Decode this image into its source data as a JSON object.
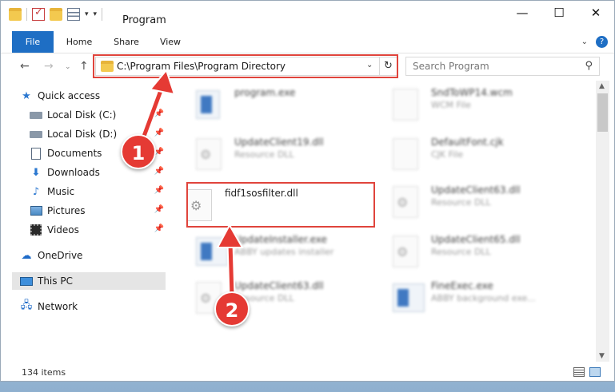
{
  "window": {
    "title": "Program"
  },
  "ribbon": {
    "tabs": [
      "File",
      "Home",
      "Share",
      "View"
    ]
  },
  "address": {
    "path": "C:\\Program Files\\Program Directory",
    "search_placeholder": "Search Program"
  },
  "sidebar": {
    "quick_access": "Quick access",
    "items": [
      {
        "label": "Local Disk (C:)"
      },
      {
        "label": "Local Disk (D:)"
      },
      {
        "label": "Documents"
      },
      {
        "label": "Downloads"
      },
      {
        "label": "Music"
      },
      {
        "label": "Pictures"
      },
      {
        "label": "Videos"
      }
    ],
    "onedrive": "OneDrive",
    "this_pc": "This PC",
    "network": "Network"
  },
  "files": {
    "program_exe": {
      "name": "program.exe"
    },
    "sndtowp": {
      "name": "SndToWP14.wcm",
      "desc": "WCM File"
    },
    "updateclient19": {
      "name": "UpdateClient19.dll",
      "desc": "Resource DLL"
    },
    "defaultfont": {
      "name": "DefaultFont.cjk",
      "desc": "CJK File"
    },
    "target": {
      "name": "fidf1sosfilter.dll"
    },
    "updateclient63a": {
      "name": "UpdateClient63.dll",
      "desc": "Resource DLL"
    },
    "updateinstaller": {
      "name": "UpdateInstaller.exe",
      "desc": "ABBY updates installer"
    },
    "updateclient65": {
      "name": "UpdateClient65.dll",
      "desc": "Resource DLL"
    },
    "updateclient63b": {
      "name": "UpdateClient63.dll",
      "desc": "Resource DLL"
    },
    "fineexec": {
      "name": "FineExec.exe",
      "desc": "ABBY background exe..."
    }
  },
  "status": {
    "item_count": "134 items"
  },
  "annotations": {
    "step1": "1",
    "step2": "2",
    "color": "#e0443c"
  }
}
